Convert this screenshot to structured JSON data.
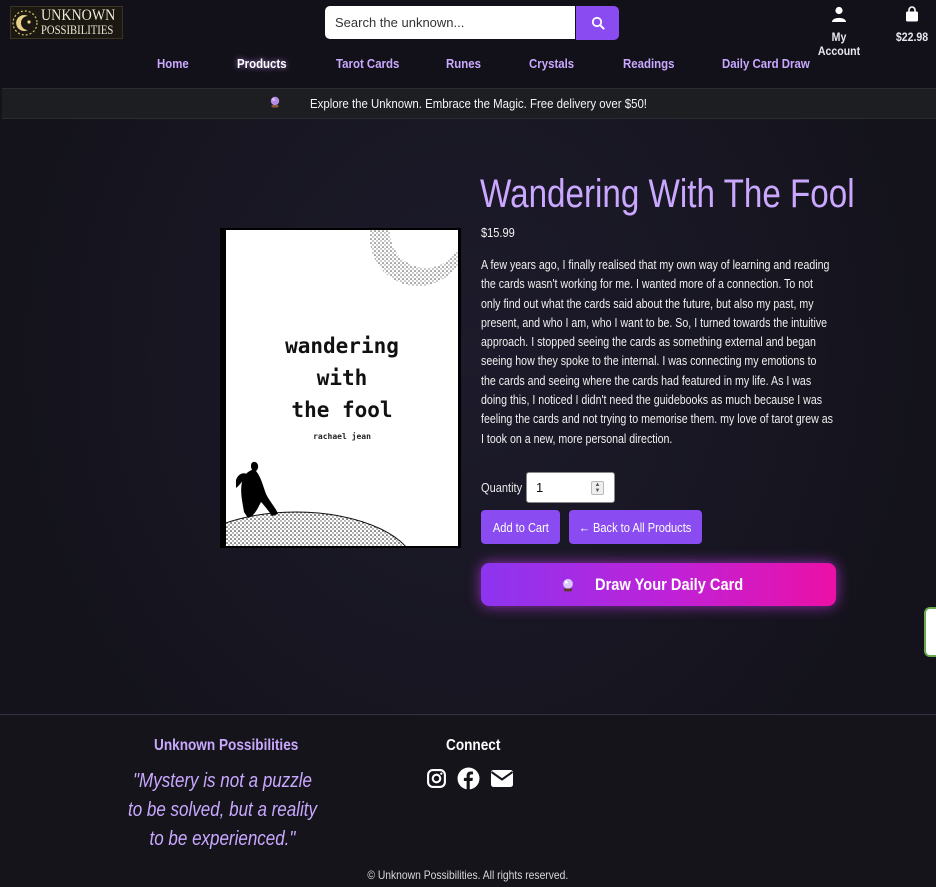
{
  "header": {
    "logo_line1": "UNKNOWN",
    "logo_line2": "POSSIBILITIES",
    "search_placeholder": "Search the unknown...",
    "account_label": "My Account",
    "cart_total": "$22.98"
  },
  "nav": {
    "items": [
      {
        "label": "Home"
      },
      {
        "label": "Products"
      },
      {
        "label": "Tarot Cards"
      },
      {
        "label": "Runes"
      },
      {
        "label": "Crystals"
      },
      {
        "label": "Readings"
      },
      {
        "label": "Daily Card Draw"
      }
    ],
    "active": "Products"
  },
  "banner": {
    "icon": "crystal-ball-icon",
    "text": "Explore the Unknown. Embrace the Magic. Free delivery over $50!"
  },
  "product": {
    "cover_title": "wandering\nwith\nthe fool",
    "cover_author": "rachael jean",
    "title": "Wandering With The Fool",
    "price": "$15.99",
    "description": "A few years ago, I finally realised that my own way of learning and reading the cards wasn't working for me. I wanted more of a connection. To not only find out what the cards said about the future, but also my past, my present, and who I am, who I want to be. So, I turned towards the intuitive approach. I stopped seeing the cards as something external and began seeing how they spoke to the internal. I was connecting my emotions to the cards and seeing where the cards had featured in my life. As I was doing this, I noticed I didn't need the guidebooks as much because I was feeling the cards and not trying to memorise them. my love of tarot grew as I took on a new, more personal direction.",
    "quantity_label": "Quantity",
    "quantity_value": "1",
    "add_to_cart_label": "Add to Cart",
    "back_label": "← Back to All Products",
    "draw_label": "Draw Your Daily Card"
  },
  "footer": {
    "brand": "Unknown Possibilities",
    "quote": "\"Mystery is not a puzzle to be solved, but a reality to be experienced.\"",
    "connect_heading": "Connect",
    "social_icons": [
      "instagram-icon",
      "facebook-icon",
      "email-icon"
    ],
    "copyright": "© Unknown Possibilities. All rights reserved."
  },
  "colors": {
    "accent": "#8a4cf0",
    "lavender": "#c9a8ff",
    "background": "#16151f",
    "draw_gradient_start": "#8c35f0",
    "draw_gradient_end": "#ec10a6"
  }
}
